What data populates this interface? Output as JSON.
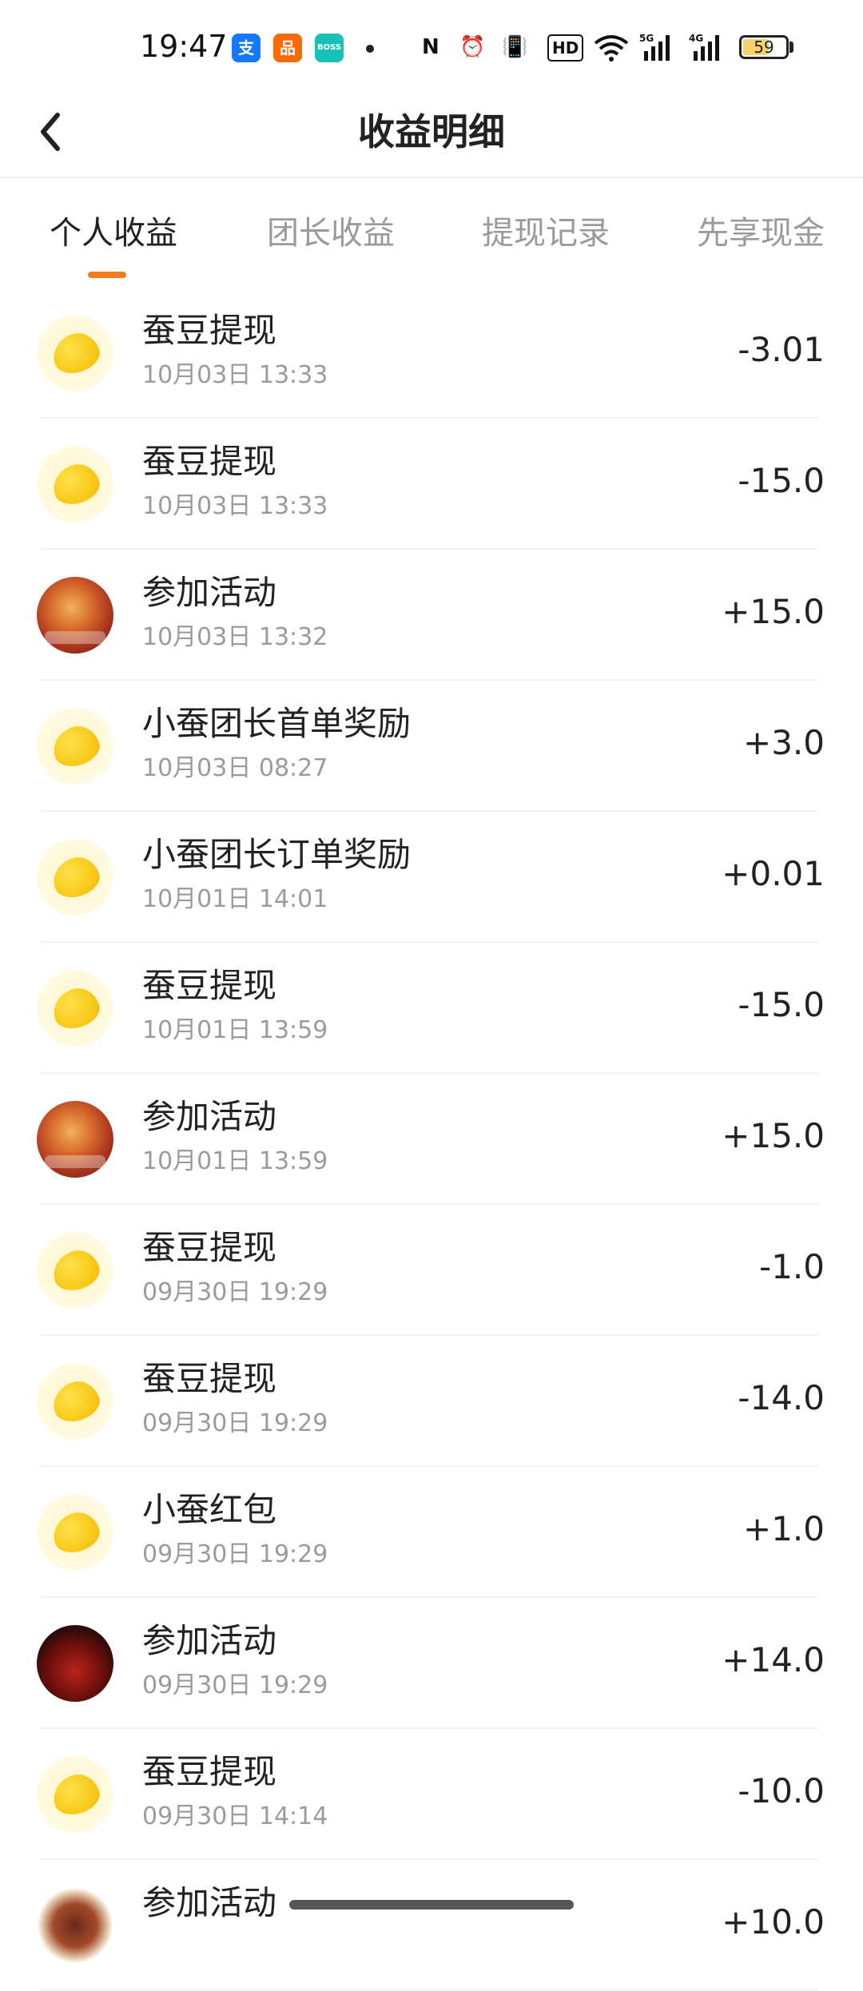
{
  "status_bar": {
    "time": "19:47",
    "apps": [
      {
        "name": "alipay-icon",
        "glyph": "支",
        "color": "#1677ff"
      },
      {
        "name": "taobao-icon",
        "glyph": "品",
        "color": "#ff6a00"
      },
      {
        "name": "boss-icon",
        "glyph": "BOSS",
        "color": "#16c2b6"
      }
    ],
    "indicators": [
      "N",
      "⏰",
      "📳",
      "HD",
      "WiFi",
      "5G",
      "4G"
    ],
    "battery_level": "59",
    "battery_fraction": 0.59
  },
  "header": {
    "title": "收益明细",
    "back_icon": "chevron-left-icon"
  },
  "tabs": [
    {
      "label": "个人收益",
      "active": true
    },
    {
      "label": "团长收益",
      "active": false
    },
    {
      "label": "提现记录",
      "active": false
    },
    {
      "label": "先享现金",
      "active": false
    }
  ],
  "accent_color": "#f47b20",
  "records": [
    {
      "avatar": "bean",
      "label": "蚕豆提现",
      "time": "10月03日 13:33",
      "amount": "-3.01"
    },
    {
      "avatar": "bean",
      "label": "蚕豆提现",
      "time": "10月03日 13:33",
      "amount": "-15.0"
    },
    {
      "avatar": "food",
      "label": "参加活动",
      "time": "10月03日 13:32",
      "amount": "+15.0"
    },
    {
      "avatar": "bean",
      "label": "小蚕团长首单奖励",
      "time": "10月03日 08:27",
      "amount": "+3.0"
    },
    {
      "avatar": "bean",
      "label": "小蚕团长订单奖励",
      "time": "10月01日 14:01",
      "amount": "+0.01"
    },
    {
      "avatar": "bean",
      "label": "蚕豆提现",
      "time": "10月01日 13:59",
      "amount": "-15.0"
    },
    {
      "avatar": "food",
      "label": "参加活动",
      "time": "10月01日 13:59",
      "amount": "+15.0"
    },
    {
      "avatar": "bean",
      "label": "蚕豆提现",
      "time": "09月30日 19:29",
      "amount": "-1.0"
    },
    {
      "avatar": "bean",
      "label": "蚕豆提现",
      "time": "09月30日 19:29",
      "amount": "-14.0"
    },
    {
      "avatar": "bean",
      "label": "小蚕红包",
      "time": "09月30日 19:29",
      "amount": "+1.0"
    },
    {
      "avatar": "dark",
      "label": "参加活动",
      "time": "09月30日 19:29",
      "amount": "+14.0"
    },
    {
      "avatar": "bean",
      "label": "蚕豆提现",
      "time": "09月30日 14:14",
      "amount": "-10.0"
    },
    {
      "avatar": "dish",
      "label": "参加活动",
      "time": "",
      "amount": "+10.0"
    }
  ]
}
